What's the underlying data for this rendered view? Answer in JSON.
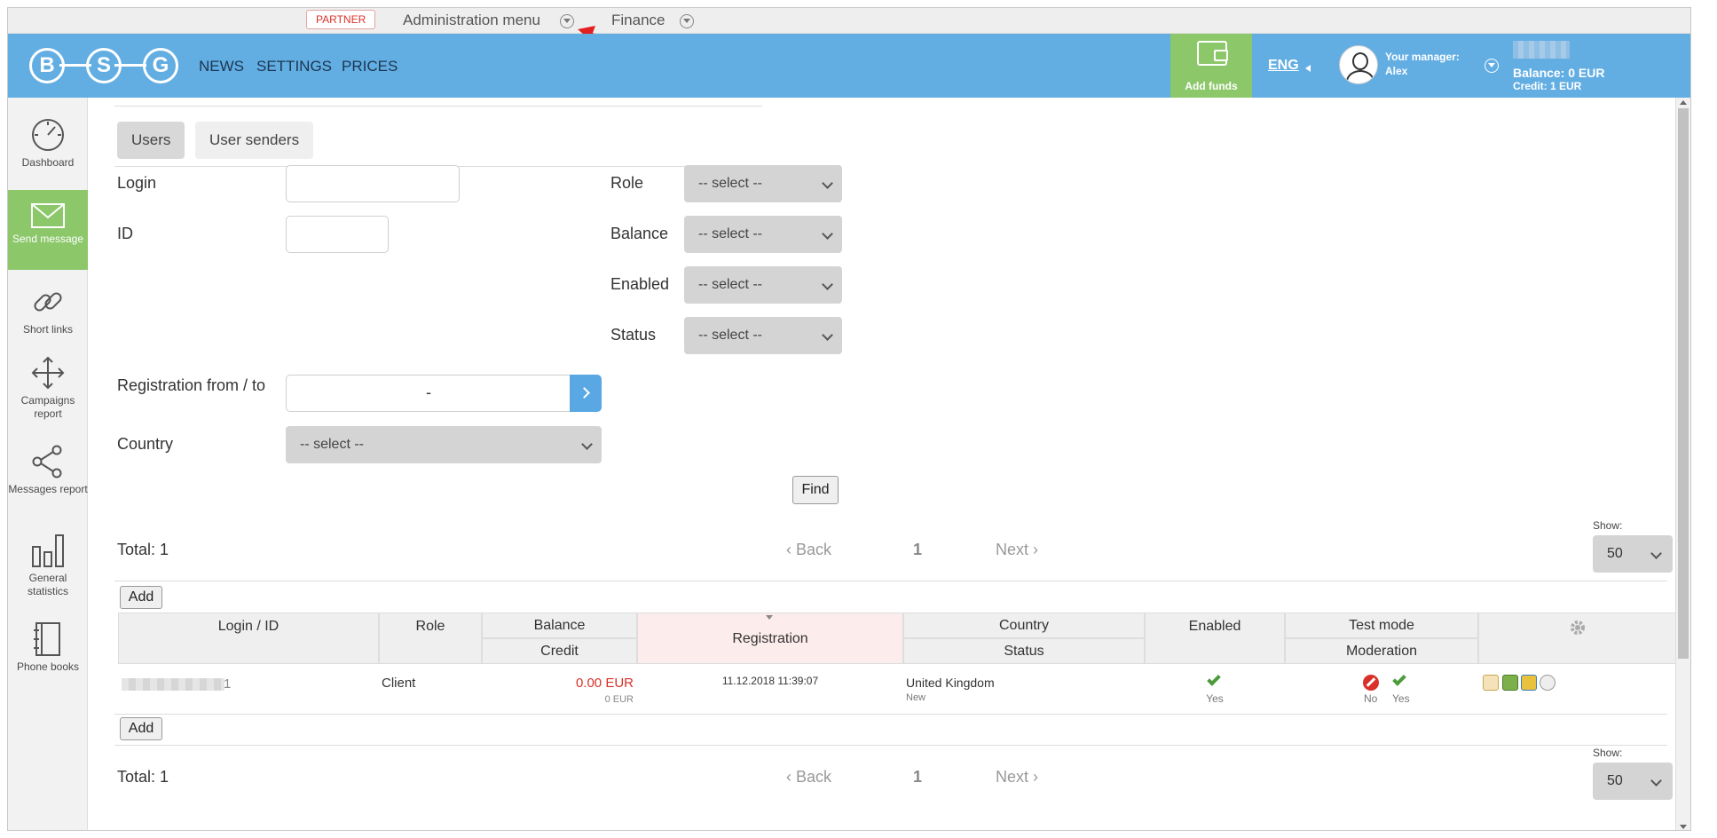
{
  "adminbar": {
    "partner": "PARTNER",
    "admin_menu": "Administration menu",
    "finance": "Finance",
    "annotation_number": "1"
  },
  "header": {
    "logo_letters": [
      "B",
      "S",
      "G"
    ],
    "nav": [
      "NEWS",
      "SETTINGS",
      "PRICES"
    ],
    "add_funds": "Add funds",
    "lang": "ENG",
    "manager_label": "Your manager:",
    "manager_name": "Alex",
    "balance": "Balance: 0 EUR",
    "credit": "Credit: 1 EUR"
  },
  "sidebar": {
    "items": [
      {
        "label": "Dashboard",
        "icon": "speedometer-icon"
      },
      {
        "label": "Send message",
        "icon": "envelope-icon",
        "active": true
      },
      {
        "label": "Short links",
        "icon": "link-icon"
      },
      {
        "label": "Campaigns report",
        "icon": "move-arrows-icon"
      },
      {
        "label": "Messages report",
        "icon": "share-icon"
      },
      {
        "label": "General statistics",
        "icon": "bar-chart-icon"
      },
      {
        "label": "Phone books",
        "icon": "notebook-icon"
      }
    ]
  },
  "tabs": [
    "Users",
    "User senders"
  ],
  "filters": {
    "login_label": "Login",
    "id_label": "ID",
    "role_label": "Role",
    "balance_label": "Balance",
    "enabled_label": "Enabled",
    "status_label": "Status",
    "select_placeholder": "-- select --",
    "registration_label": "Registration from / to",
    "date_separator": "-",
    "country_label": "Country",
    "find_button": "Find"
  },
  "pagination": {
    "total": "Total: 1",
    "back": "Back",
    "page": "1",
    "next": "Next",
    "show_label": "Show:",
    "show_value": "50"
  },
  "table": {
    "add_button": "Add",
    "headers": {
      "login_id": "Login / ID",
      "role": "Role",
      "balance": "Balance",
      "credit": "Credit",
      "registration": "Registration",
      "country": "Country",
      "status": "Status",
      "enabled": "Enabled",
      "test_mode": "Test mode",
      "moderation": "Moderation"
    },
    "rows": [
      {
        "login_suffix": "1",
        "role": "Client",
        "balance": "0.00 EUR",
        "credit": "0 EUR",
        "registration": "11.12.2018 11:39:07",
        "country": "United Kingdom",
        "status": "New",
        "enabled": "Yes",
        "test_mode": "No",
        "moderation": "Yes"
      }
    ]
  },
  "colors": {
    "header_bg": "#62aee3",
    "accent_green": "#8cc76a",
    "negative_red": "#d9312a"
  }
}
